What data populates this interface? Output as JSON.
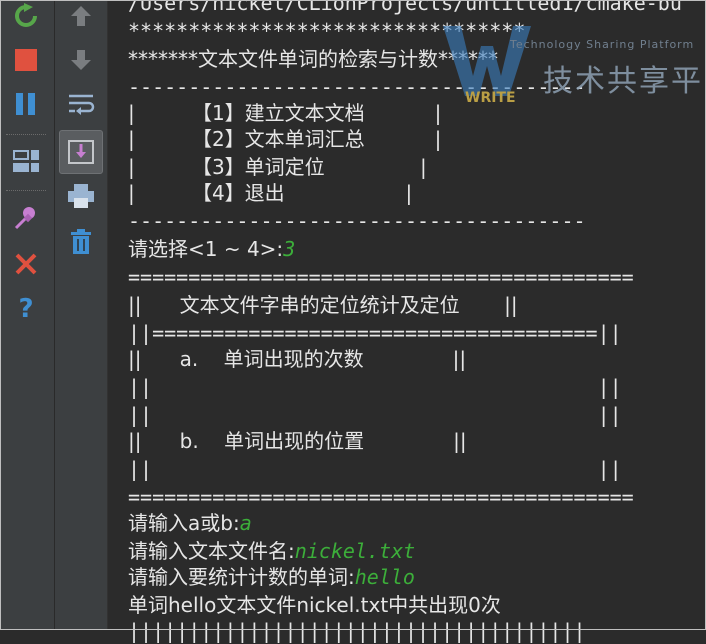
{
  "toolbar": {
    "left": [
      {
        "name": "rerun-icon",
        "color": "#57a64a"
      },
      {
        "name": "stop-icon",
        "color": "#e0513f"
      },
      {
        "name": "pause-icon",
        "color": "#3f8fd2"
      },
      {
        "name": "layout-icon",
        "color": "#9ab4d1"
      },
      {
        "name": "pin-icon",
        "color": "#c77fd1"
      },
      {
        "name": "close-icon",
        "color": "#e0513f"
      },
      {
        "name": "help-icon",
        "color": "#3f8fd2"
      }
    ],
    "right": [
      {
        "name": "up-arrow-icon"
      },
      {
        "name": "down-arrow-icon"
      },
      {
        "name": "soft-wrap-icon"
      },
      {
        "name": "scroll-to-end-icon"
      },
      {
        "name": "print-icon"
      },
      {
        "name": "trash-icon"
      }
    ]
  },
  "console": {
    "lines": [
      {
        "text": "/Users/nickel/CLionProjects/untitled1/cmake-bu",
        "cjk": false
      },
      {
        "text": "*********************************",
        "cjk": false
      },
      {
        "text": "*******文本文件单词的检索与计数******",
        "cjk": true
      },
      {
        "text": "--------------------------------------",
        "cjk": false
      },
      {
        "text": "|         【1】建立文本文档           |",
        "cjk": true
      },
      {
        "text": "|         【2】文本单词汇总           |",
        "cjk": true
      },
      {
        "text": "|         【3】单词定位               |",
        "cjk": true
      },
      {
        "text": "|         【4】退出                   |",
        "cjk": true
      },
      {
        "text": "--------------------------------------",
        "cjk": false
      },
      {
        "text": "请选择<1 ~ 4>:",
        "cjk": true,
        "input": "3"
      },
      {
        "text": "==========================================",
        "cjk": false
      },
      {
        "text": "||      文本文件字串的定位统计及定位       ||",
        "cjk": true
      },
      {
        "text": "||=====================================||",
        "cjk": false
      },
      {
        "text": "||      a.    单词出现的次数              ||",
        "cjk": true
      },
      {
        "text": "||                                     ||",
        "cjk": false
      },
      {
        "text": "||                                     ||",
        "cjk": false
      },
      {
        "text": "||      b.    单词出现的位置              ||",
        "cjk": true
      },
      {
        "text": "||                                     ||",
        "cjk": false
      },
      {
        "text": "==========================================",
        "cjk": false
      },
      {
        "text": "请输入a或b:",
        "cjk": true,
        "input": "a"
      },
      {
        "text": "请输入文本文件名:",
        "cjk": true,
        "input": "nickel.txt"
      },
      {
        "text": "请输入要统计计数的单词:",
        "cjk": true,
        "input": "hello"
      },
      {
        "text": "单词hello文本文件nickel.txt中共出现0次",
        "cjk": true
      },
      {
        "text": "||||||||||||||||||||||||||||||||||||||",
        "cjk": false
      }
    ]
  },
  "watermark": {
    "small": "Technology Sharing Platform",
    "big": "技术共享平台",
    "logo_text": "WRITE"
  }
}
